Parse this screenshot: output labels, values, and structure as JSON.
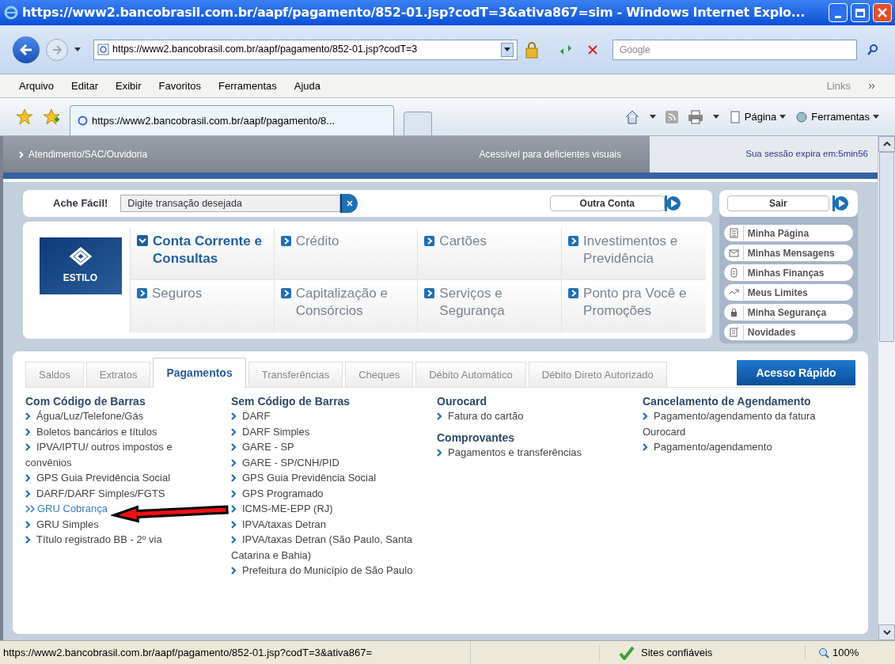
{
  "window": {
    "title": "https://www2.bancobrasil.com.br/aapf/pagamento/852-01.jsp?codT=3&ativa867=sim - Windows Internet Explo..."
  },
  "address_bar": {
    "value": "https://www2.bancobrasil.com.br/aapf/pagamento/852-01.jsp?codT=3"
  },
  "search": {
    "placeholder": "Google"
  },
  "menu": [
    "Arquivo",
    "Editar",
    "Exibir",
    "Favoritos",
    "Ferramentas",
    "Ajuda"
  ],
  "links_label": "Links",
  "browser_tab": {
    "label": "https://www2.bancobrasil.com.br/aapf/pagamento/8..."
  },
  "command_bar": [
    "Página",
    "Ferramentas"
  ],
  "site_header": {
    "left": "Atendimento/SAC/Ouvidoria",
    "middle": "Acessível para deficientes visuais",
    "session": "Sua sessão expira em:5min56"
  },
  "finder": {
    "label": "Ache Fácil!",
    "placeholder": "Digite transação desejada"
  },
  "other_account": "Outra Conta",
  "logout": "Sair",
  "logo_text": "ESTILO",
  "categories": [
    {
      "label": "Conta Corrente e Consultas",
      "selected": true
    },
    {
      "label": "Crédito",
      "selected": false
    },
    {
      "label": "Cartões",
      "selected": false
    },
    {
      "label": "Investimentos e Previdência",
      "selected": false
    },
    {
      "label": "Seguros",
      "selected": false
    },
    {
      "label": "Capitalização e Consórcios",
      "selected": false
    },
    {
      "label": "Serviços e Segurança",
      "selected": false
    },
    {
      "label": "Ponto pra Você e Promoções",
      "selected": false
    }
  ],
  "quick_links": [
    {
      "label": "Minha Página",
      "kind": "page"
    },
    {
      "label": "Minhas Mensagens",
      "kind": "mail"
    },
    {
      "label": "Minhas Finanças",
      "kind": "coin"
    },
    {
      "label": "Meus Limites",
      "kind": "limit"
    },
    {
      "label": "Minha Segurança",
      "kind": "lock"
    },
    {
      "label": "Novidades",
      "kind": "news"
    }
  ],
  "tabs": [
    {
      "label": "Saldos",
      "selected": false
    },
    {
      "label": "Extratos",
      "selected": false
    },
    {
      "label": "Pagamentos",
      "selected": true
    },
    {
      "label": "Transferências",
      "selected": false
    },
    {
      "label": "Cheques",
      "selected": false
    },
    {
      "label": "Débito Automático",
      "selected": false
    },
    {
      "label": "Débito Direto Autorizado",
      "selected": false
    }
  ],
  "quick_access": "Acesso Rápido",
  "columns": [
    [
      {
        "title": "Com Código de Barras",
        "links": [
          {
            "label": "Água/Luz/Telefone/Gás",
            "selected": false
          },
          {
            "label": "Boletos bancários e títulos",
            "selected": false
          },
          {
            "label": "IPVA/IPTU/ outros impostos e convênios",
            "selected": false
          },
          {
            "label": "GPS Guia Previdência Social",
            "selected": false
          },
          {
            "label": "DARF/DARF Simples/FGTS",
            "selected": false
          },
          {
            "label": "GRU Cobrança",
            "selected": true
          },
          {
            "label": "GRU Simples",
            "selected": false
          },
          {
            "label": "Título registrado BB - 2º via",
            "selected": false
          }
        ]
      }
    ],
    [
      {
        "title": "Sem Código de Barras",
        "links": [
          {
            "label": "DARF",
            "selected": false
          },
          {
            "label": "DARF Simples",
            "selected": false
          },
          {
            "label": "GARE - SP",
            "selected": false
          },
          {
            "label": "GARE - SP/CNH/PID",
            "selected": false
          },
          {
            "label": "GPS Guia Previdência Social",
            "selected": false
          },
          {
            "label": "GPS Programado",
            "selected": false
          },
          {
            "label": "ICMS-ME-EPP (RJ)",
            "selected": false
          },
          {
            "label": "IPVA/taxas Detran",
            "selected": false
          },
          {
            "label": "IPVA/taxas Detran (São Paulo, Santa Catarina e Bahia)",
            "selected": false
          },
          {
            "label": "Prefeitura do Município de São Paulo",
            "selected": false
          }
        ]
      }
    ],
    [
      {
        "title": "Ourocard",
        "links": [
          {
            "label": "Fatura do cartão",
            "selected": false
          }
        ]
      },
      {
        "title": "Comprovantes",
        "links": [
          {
            "label": "Pagamentos e transferências",
            "selected": false
          }
        ]
      }
    ],
    [
      {
        "title": "Cancelamento de Agendamento",
        "links": [
          {
            "label": "Pagamento/agendamento da fatura Ourocard",
            "selected": false
          },
          {
            "label": "Pagamento/agendamento",
            "selected": false
          }
        ]
      }
    ]
  ],
  "status_bar": {
    "url": "https://www2.bancobrasil.com.br/aapf/pagamento/852-01.jsp?codT=3&ativa867=",
    "zone": "Sites confiáveis",
    "zoom": "100%"
  }
}
